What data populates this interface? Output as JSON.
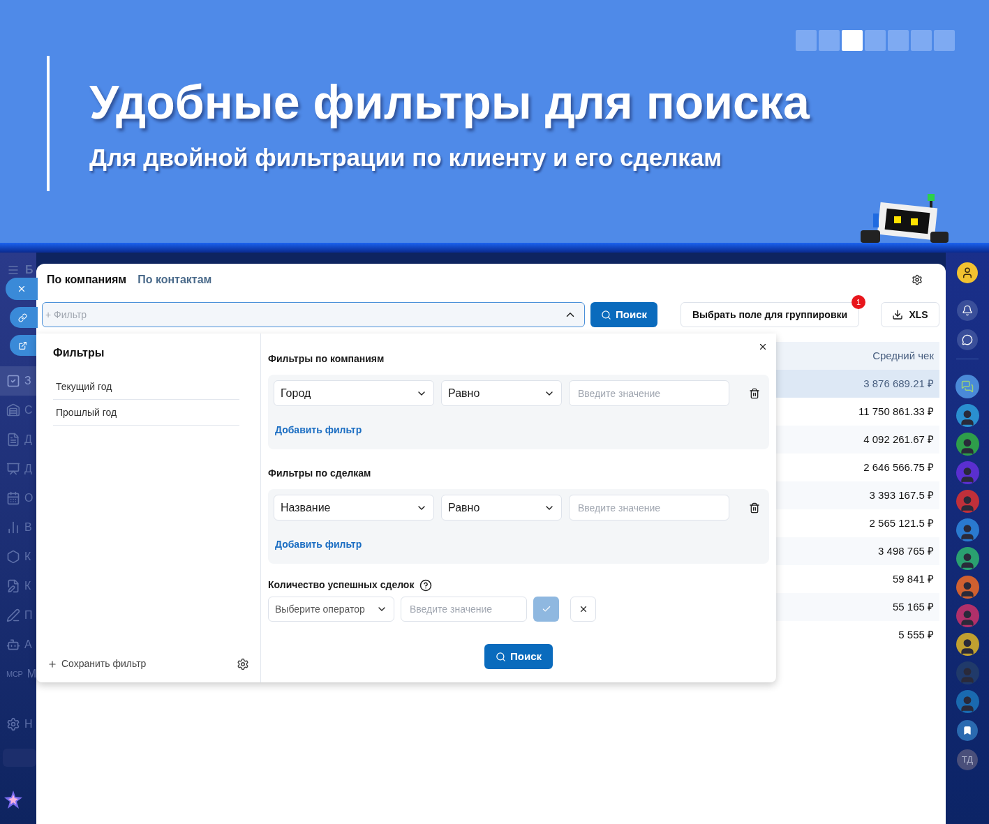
{
  "banner": {
    "title": "Удобные фильтры для поиска",
    "subtitle": "Для двойной фильтрации по клиенту и его сделкам",
    "slides": [
      {
        "selected": false
      },
      {
        "selected": false
      },
      {
        "selected": true
      },
      {
        "selected": false
      },
      {
        "selected": false
      },
      {
        "selected": false
      },
      {
        "selected": false
      }
    ]
  },
  "left_nav": {
    "title_letter": "Б",
    "items": [
      {
        "kind": "tasks",
        "letter": "З",
        "selected": true
      },
      {
        "kind": "warehouse",
        "letter": "С",
        "selected": false
      },
      {
        "kind": "document",
        "letter": "Д",
        "selected": false
      },
      {
        "kind": "presentation",
        "letter": "Д",
        "selected": false
      },
      {
        "kind": "calendar",
        "letter": "О",
        "selected": false
      },
      {
        "kind": "chart",
        "letter": "В",
        "selected": false
      },
      {
        "kind": "hexagon",
        "letter": "К",
        "selected": false
      },
      {
        "kind": "edit-doc",
        "letter": "К",
        "selected": false
      },
      {
        "kind": "pen",
        "letter": "П",
        "selected": false
      },
      {
        "kind": "robot",
        "letter": "А",
        "selected": false
      },
      {
        "kind": "mcp",
        "icon_text": "MCP",
        "letter": "М",
        "selected": false
      },
      {
        "kind": "settings",
        "letter": "Н",
        "selected": false
      }
    ]
  },
  "tabs": [
    {
      "label": "По компаниям",
      "selected": true
    },
    {
      "label": "По контактам",
      "selected": false
    }
  ],
  "toolbar": {
    "filter": {
      "placeholder": "+ Фильтр",
      "expanded": true
    },
    "search_button": "Поиск",
    "group_button": "Выбрать поле для группировки",
    "group_badge": "1",
    "export_button": "XLS"
  },
  "table": {
    "column": "Средний чек",
    "rows": [
      {
        "value": "3 876 689.21 ₽",
        "selected": true
      },
      {
        "value": "11 750 861.33 ₽",
        "selected": false
      },
      {
        "value": "4 092 261.67 ₽",
        "selected": false
      },
      {
        "value": "2 646 566.75 ₽",
        "selected": false
      },
      {
        "value": "3 393 167.5 ₽",
        "selected": false
      },
      {
        "value": "2 565 121.5 ₽",
        "selected": false
      },
      {
        "value": "3 498 765 ₽",
        "selected": false
      },
      {
        "value": "59 841 ₽",
        "selected": false
      },
      {
        "value": "55 165 ₽",
        "selected": false
      },
      {
        "value": "5 555 ₽",
        "selected": false
      }
    ]
  },
  "filter_panel": {
    "heading": "Фильтры",
    "saved": [
      "Текущий год",
      "Прошлый год"
    ],
    "save_button": "Сохранить фильтр",
    "sections": [
      {
        "title": "Фильтры по компаниям",
        "rows": [
          {
            "field": "Город",
            "operator": "Равно",
            "placeholder": "Введите значение"
          }
        ],
        "add_link": "Добавить фильтр"
      },
      {
        "title": "Фильтры по сделкам",
        "rows": [
          {
            "field": "Название",
            "operator": "Равно",
            "placeholder": "Введите значение"
          }
        ],
        "add_link": "Добавить фильтр"
      }
    ],
    "count": {
      "label": "Количество успешных сделок",
      "operator_placeholder": "Выберите оператор",
      "value_placeholder": "Введите значение",
      "confirm_disabled": true
    },
    "search_button": "Поиск"
  },
  "right_rail": {
    "contacts": [
      {
        "color": "#2a8fd0"
      },
      {
        "color": "#2e9e4a"
      },
      {
        "color": "#5a2fd0"
      },
      {
        "color": "#c0303a"
      },
      {
        "color": "#2a7ad0"
      },
      {
        "color": "#2aa070"
      },
      {
        "color": "#d06030"
      },
      {
        "color": "#b0306a"
      },
      {
        "color": "#c0a030"
      },
      {
        "color": "#203a6a"
      },
      {
        "color": "#1a6ab0"
      }
    ],
    "initials": "ТД"
  }
}
